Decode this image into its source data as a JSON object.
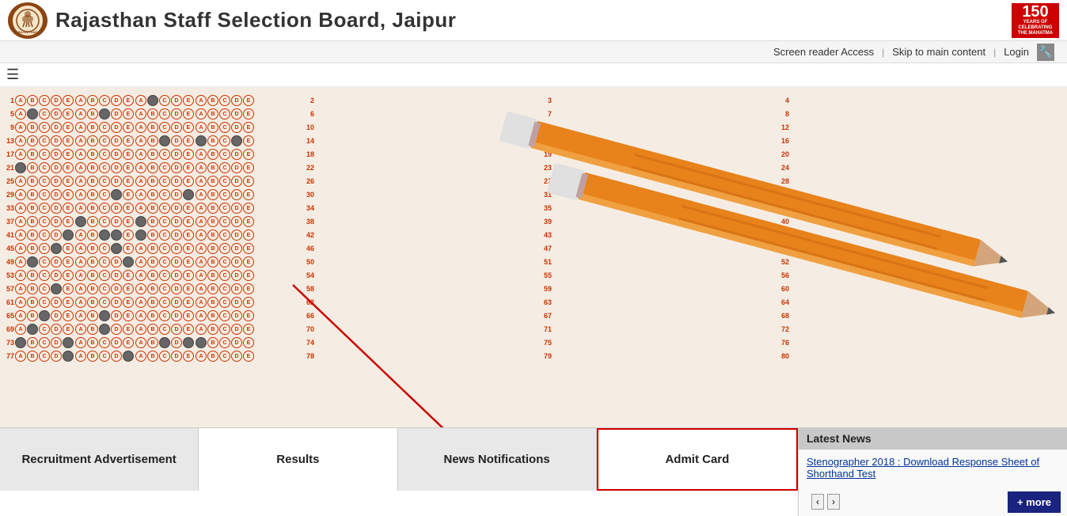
{
  "header": {
    "title": "Rajasthan Staff Selection Board, Jaipur",
    "logo_alt": "Rajasthan Emblem",
    "right_logo_num": "150",
    "right_logo_text": "YEARS OF\nCELEBRATING\nTHE MAHATMA"
  },
  "topnav": {
    "screen_reader": "Screen reader Access",
    "skip_main": "Skip to main content",
    "login": "Login",
    "tool_icon": "🔧"
  },
  "tabs": [
    {
      "id": "recruitment",
      "label": "Recruitment Advertisement",
      "active": false,
      "odd": true
    },
    {
      "id": "results",
      "label": "Results",
      "active": false,
      "odd": false
    },
    {
      "id": "news",
      "label": "News Notifications",
      "active": false,
      "odd": true
    },
    {
      "id": "admit",
      "label": "Admit Card",
      "active": true,
      "odd": false
    }
  ],
  "news_panel": {
    "header": "Latest News",
    "item1": "Stenographer 2018 : Download Response Sheet of Shorthand Test",
    "more_label": "+ more",
    "prev": "‹",
    "next": "›"
  }
}
